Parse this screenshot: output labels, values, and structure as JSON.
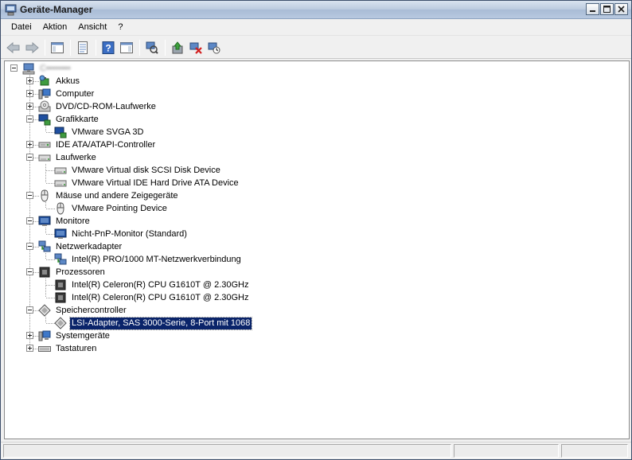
{
  "window": {
    "title": "Geräte-Manager"
  },
  "menubar": {
    "items": [
      "Datei",
      "Aktion",
      "Ansicht",
      "?"
    ]
  },
  "toolbar": {
    "buttons": [
      "back-arrow",
      "forward-arrow",
      "show-hide-console-tree",
      "properties",
      "help",
      "action-pane",
      "scan-hardware-changes",
      "update-driver",
      "uninstall-device",
      "disable-device"
    ]
  },
  "tree": {
    "root": {
      "label": "C••••••••"
    },
    "categories": [
      {
        "label": "Akkus",
        "icon": "battery-icon",
        "expanded": false
      },
      {
        "label": "Computer",
        "icon": "computer-icon",
        "expanded": false
      },
      {
        "label": "DVD/CD-ROM-Laufwerke",
        "icon": "dvd-drive-icon",
        "expanded": false
      },
      {
        "label": "Grafikkarte",
        "icon": "display-adapter-icon",
        "expanded": true,
        "children": [
          "VMware SVGA 3D"
        ]
      },
      {
        "label": "IDE ATA/ATAPI-Controller",
        "icon": "ide-controller-icon",
        "expanded": false
      },
      {
        "label": "Laufwerke",
        "icon": "disk-drive-icon",
        "expanded": true,
        "children": [
          "VMware Virtual disk SCSI Disk Device",
          "VMware Virtual IDE Hard Drive ATA Device"
        ]
      },
      {
        "label": "Mäuse und andere Zeigegeräte",
        "icon": "mouse-icon",
        "expanded": true,
        "children": [
          "VMware Pointing Device"
        ]
      },
      {
        "label": "Monitore",
        "icon": "monitor-icon",
        "expanded": true,
        "children": [
          "Nicht-PnP-Monitor (Standard)"
        ]
      },
      {
        "label": "Netzwerkadapter",
        "icon": "network-adapter-icon",
        "expanded": true,
        "children": [
          "Intel(R) PRO/1000 MT-Netzwerkverbindung"
        ]
      },
      {
        "label": "Prozessoren",
        "icon": "processor-icon",
        "expanded": true,
        "children": [
          "Intel(R) Celeron(R) CPU G1610T @ 2.30GHz",
          "Intel(R) Celeron(R) CPU G1610T @ 2.30GHz"
        ]
      },
      {
        "label": "Speichercontroller",
        "icon": "storage-controller-icon",
        "expanded": true,
        "children": [
          "LSI-Adapter, SAS 3000-Serie, 8-Port mit 1068"
        ]
      },
      {
        "label": "Systemgeräte",
        "icon": "system-devices-icon",
        "expanded": false
      },
      {
        "label": "Tastaturen",
        "icon": "keyboard-icon",
        "expanded": false
      }
    ],
    "selected": "LSI-Adapter, SAS 3000-Serie, 8-Port mit 1068"
  },
  "statusbar": {
    "panes": [
      "",
      "",
      ""
    ]
  },
  "colors": {
    "selection": "#0a246a",
    "titlebar": "#bccbdf",
    "window_bg": "#f0f0f0"
  }
}
